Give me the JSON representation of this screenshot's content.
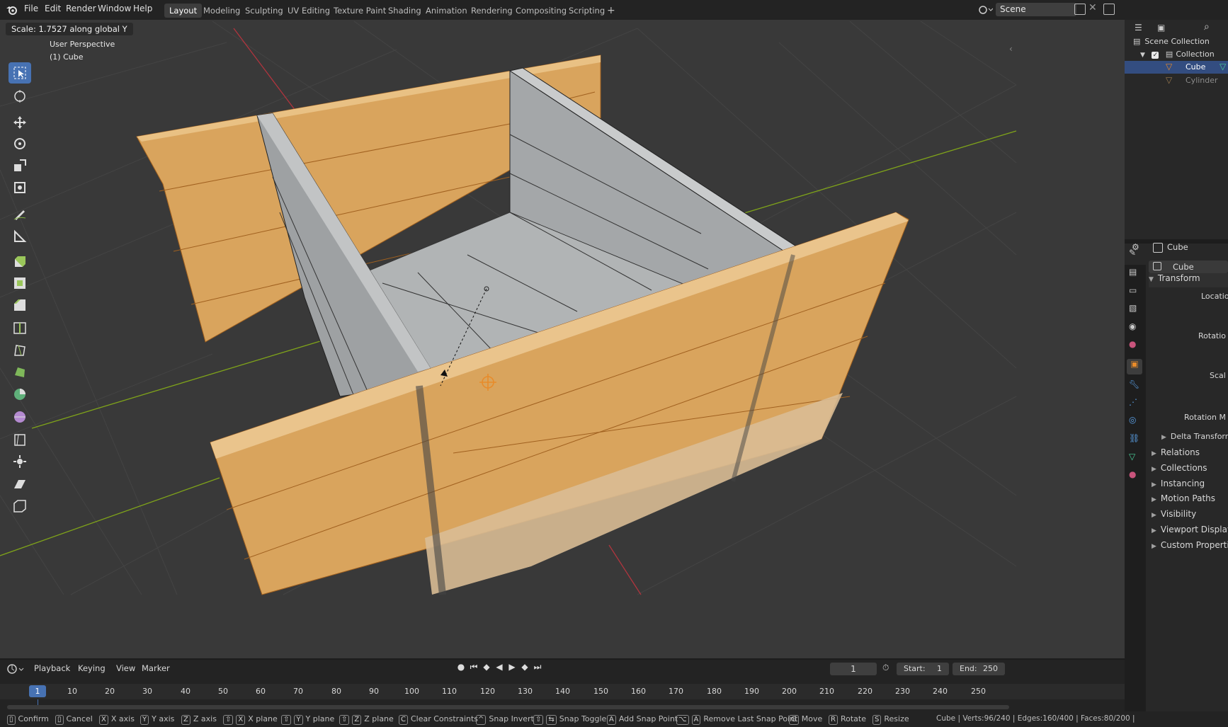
{
  "topbar": {
    "menus": [
      "File",
      "Edit",
      "Render",
      "Window",
      "Help"
    ],
    "workspaces": [
      "Layout",
      "Modeling",
      "Sculpting",
      "UV Editing",
      "Texture Paint",
      "Shading",
      "Animation",
      "Rendering",
      "Compositing",
      "Scripting"
    ],
    "active_workspace": "Layout",
    "add_tab": "+",
    "scene_name": "Scene"
  },
  "viewport": {
    "operator_status": "Scale: 1.7527 along global Y",
    "view_name": "User Perspective",
    "object_label": "(1) Cube"
  },
  "outliner": {
    "scene_collection": "Scene Collection",
    "collection": "Collection",
    "items": [
      "Cube",
      "Cylinder"
    ]
  },
  "properties": {
    "object_name": "Cube",
    "data_name": "Cube",
    "transform": "Transform",
    "location": "Locatio",
    "rotation": "Rotatio",
    "scale": "Scal",
    "rotation_mode": "Rotation M",
    "delta": "Delta Transform",
    "sections": [
      "Relations",
      "Collections",
      "Instancing",
      "Motion Paths",
      "Visibility",
      "Viewport Display",
      "Custom Propertie"
    ]
  },
  "timeline": {
    "menus": [
      "Playback",
      "Keying",
      "View",
      "Marker"
    ],
    "current_frame": "1",
    "start_label": "Start:",
    "start": "1",
    "end_label": "End:",
    "end": "250",
    "ruler": [
      "1",
      "10",
      "20",
      "30",
      "40",
      "50",
      "60",
      "70",
      "80",
      "90",
      "100",
      "110",
      "120",
      "130",
      "140",
      "150",
      "160",
      "170",
      "180",
      "190",
      "200",
      "210",
      "220",
      "230",
      "240",
      "250"
    ]
  },
  "statusbar": {
    "confirm": "Confirm",
    "cancel": "Cancel",
    "x_key": "X",
    "x_axis": "X axis",
    "y_key": "Y",
    "y_axis": "Y axis",
    "z_key": "Z",
    "z_axis": "Z axis",
    "x_plane": "X plane",
    "y_plane": "Y plane",
    "z_plane": "Z plane",
    "c_key": "C",
    "clear_constraints": "Clear Constraints",
    "snap_invert": "Snap Invert",
    "snap_toggle": "Snap Toggle",
    "a_key": "A",
    "add_snap": "Add Snap Point",
    "remove_snap": "Remove Last Snap Point",
    "g_key": "G",
    "move": "Move",
    "r_key": "R",
    "rotate": "Rotate",
    "s_key": "S",
    "resize": "Resize",
    "stats": "Cube | Verts:96/240 | Edges:160/400 | Faces:80/200 |"
  },
  "colors": {
    "selected_face": "#d9a45d",
    "unselected_face": "#a4a7a9",
    "accent": "#4772b3",
    "x_axis": "#b0353e",
    "y_axis": "#7fa31a"
  }
}
